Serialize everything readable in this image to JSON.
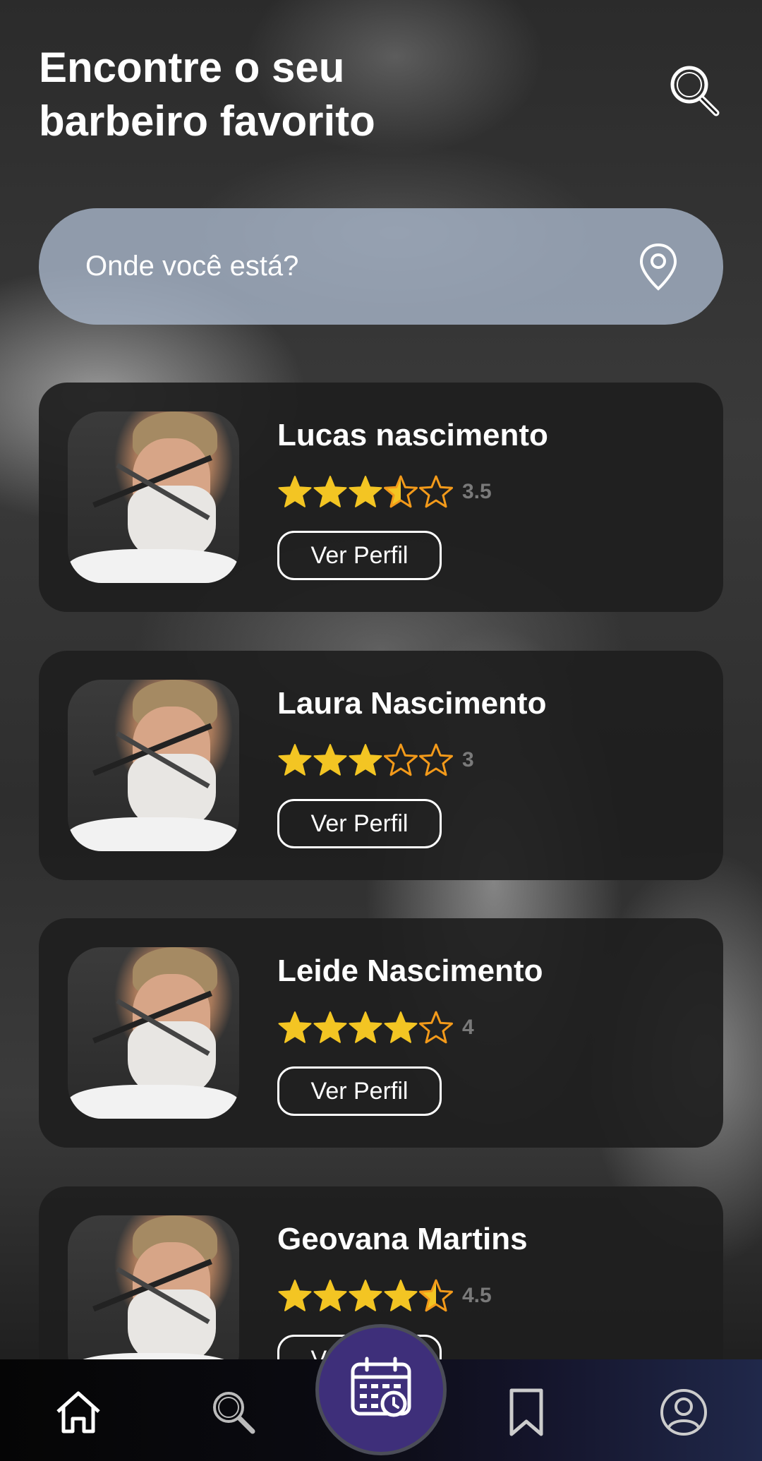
{
  "header": {
    "title_line1": "Encontre o seu",
    "title_line2": "barbeiro favorito"
  },
  "location": {
    "placeholder": "Onde você está?"
  },
  "barbers": [
    {
      "name": "Lucas nascimento",
      "rating": 3.5,
      "rating_label": "3.5",
      "button": "Ver Perfil"
    },
    {
      "name": "Laura Nascimento",
      "rating": 3,
      "rating_label": "3",
      "button": "Ver Perfil"
    },
    {
      "name": "Leide Nascimento",
      "rating": 4,
      "rating_label": "4",
      "button": "Ver Perfil"
    },
    {
      "name": "Geovana Martins",
      "rating": 4.5,
      "rating_label": "4.5",
      "button": "Ver Perfil"
    }
  ],
  "nav": {
    "items": [
      "home-icon",
      "search-icon",
      "calendar-icon",
      "bookmark-icon",
      "profile-icon"
    ],
    "active": "calendar-icon"
  },
  "colors": {
    "star_filled": "#f3c523",
    "star_outline": "#f39a1a",
    "fab": "#3e2f7a",
    "location_bar": "#aab9cd"
  }
}
